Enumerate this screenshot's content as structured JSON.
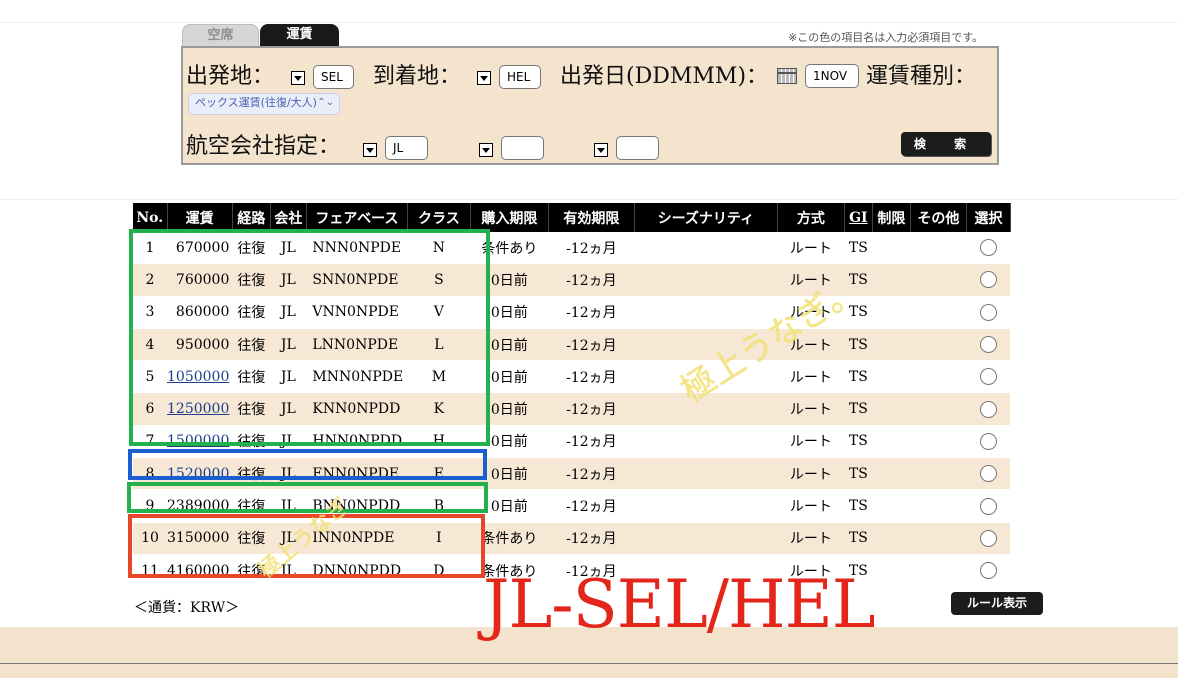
{
  "tabs": [
    {
      "label": "空席",
      "active": false
    },
    {
      "label": "運賃",
      "active": true
    }
  ],
  "note": "※この色の項目名は入力必須項目です。",
  "search": {
    "origin_label": "出発地：",
    "origin_value": "SEL",
    "dest_label": "到着地：",
    "dest_value": "HEL",
    "date_label": "出発日(DDMMM)：",
    "date_value": "1NOV",
    "fare_type_label": "運賃種別：",
    "fare_type_value": "ペックス運賃(往復/大人)",
    "airline_label": "航空会社指定：",
    "airline_values": [
      "JL",
      "",
      ""
    ],
    "search_button": "検 索"
  },
  "table": {
    "columns": [
      "No.",
      "運賃",
      "経路",
      "会社",
      "フェアベース",
      "クラス",
      "購入期限",
      "有効期限",
      "シーズナリティ",
      "方式",
      "GI",
      "制限",
      "その他",
      "選択"
    ],
    "rows": [
      {
        "no": "1",
        "fare": "670000",
        "link": false,
        "route": "往復",
        "airline": "JL",
        "fare_basis": "NNN0NPDE",
        "class": "N",
        "purchase": "条件あり",
        "validity": "-12ヵ月",
        "seasonality": "",
        "method": "ルート",
        "gi": "TS",
        "restriction": "",
        "other": ""
      },
      {
        "no": "2",
        "fare": "760000",
        "link": false,
        "route": "往復",
        "airline": "JL",
        "fare_basis": "SNN0NPDE",
        "class": "S",
        "purchase": "0日前",
        "validity": "-12ヵ月",
        "seasonality": "",
        "method": "ルート",
        "gi": "TS",
        "restriction": "",
        "other": ""
      },
      {
        "no": "3",
        "fare": "860000",
        "link": false,
        "route": "往復",
        "airline": "JL",
        "fare_basis": "VNN0NPDE",
        "class": "V",
        "purchase": "0日前",
        "validity": "-12ヵ月",
        "seasonality": "",
        "method": "ルート",
        "gi": "TS",
        "restriction": "",
        "other": ""
      },
      {
        "no": "4",
        "fare": "950000",
        "link": false,
        "route": "往復",
        "airline": "JL",
        "fare_basis": "LNN0NPDE",
        "class": "L",
        "purchase": "0日前",
        "validity": "-12ヵ月",
        "seasonality": "",
        "method": "ルート",
        "gi": "TS",
        "restriction": "",
        "other": ""
      },
      {
        "no": "5",
        "fare": "1050000",
        "link": true,
        "route": "往復",
        "airline": "JL",
        "fare_basis": "MNN0NPDE",
        "class": "M",
        "purchase": "0日前",
        "validity": "-12ヵ月",
        "seasonality": "",
        "method": "ルート",
        "gi": "TS",
        "restriction": "",
        "other": ""
      },
      {
        "no": "6",
        "fare": "1250000",
        "link": true,
        "route": "往復",
        "airline": "JL",
        "fare_basis": "KNN0NPDD",
        "class": "K",
        "purchase": "0日前",
        "validity": "-12ヵ月",
        "seasonality": "",
        "method": "ルート",
        "gi": "TS",
        "restriction": "",
        "other": ""
      },
      {
        "no": "7",
        "fare": "1500000",
        "link": true,
        "route": "往復",
        "airline": "JL",
        "fare_basis": "HNN0NPDD",
        "class": "H",
        "purchase": "0日前",
        "validity": "-12ヵ月",
        "seasonality": "",
        "method": "ルート",
        "gi": "TS",
        "restriction": "",
        "other": ""
      },
      {
        "no": "8",
        "fare": "1520000",
        "link": true,
        "route": "往復",
        "airline": "JL",
        "fare_basis": "ENN0NPDE",
        "class": "E",
        "purchase": "0日前",
        "validity": "-12ヵ月",
        "seasonality": "",
        "method": "ルート",
        "gi": "TS",
        "restriction": "",
        "other": ""
      },
      {
        "no": "9",
        "fare": "2389000",
        "link": false,
        "route": "往復",
        "airline": "JL",
        "fare_basis": "BNN0NPDD",
        "class": "B",
        "purchase": "0日前",
        "validity": "-12ヵ月",
        "seasonality": "",
        "method": "ルート",
        "gi": "TS",
        "restriction": "",
        "other": ""
      },
      {
        "no": "10",
        "fare": "3150000",
        "link": false,
        "route": "往復",
        "airline": "JL",
        "fare_basis": "INN0NPDE",
        "class": "I",
        "purchase": "条件あり",
        "validity": "-12ヵ月",
        "seasonality": "",
        "method": "ルート",
        "gi": "TS",
        "restriction": "",
        "other": ""
      },
      {
        "no": "11",
        "fare": "4160000",
        "link": false,
        "route": "往復",
        "airline": "JL",
        "fare_basis": "DNN0NPDD",
        "class": "D",
        "purchase": "条件あり",
        "validity": "-12ヵ月",
        "seasonality": "",
        "method": "ルート",
        "gi": "TS",
        "restriction": "",
        "other": ""
      }
    ]
  },
  "currency": "＜通貨：KRW＞",
  "rule_button": "ルール表示",
  "annotations": {
    "title": "JL-SEL/HEL",
    "handwriting_1": "極上うなぎ。",
    "handwriting_2": "極上うなぎ",
    "colors": {
      "green": "#22b14c",
      "blue": "#1a5fd0",
      "red": "#e8462b",
      "title": "#e32619",
      "handwriting": "#f2e37a"
    }
  }
}
